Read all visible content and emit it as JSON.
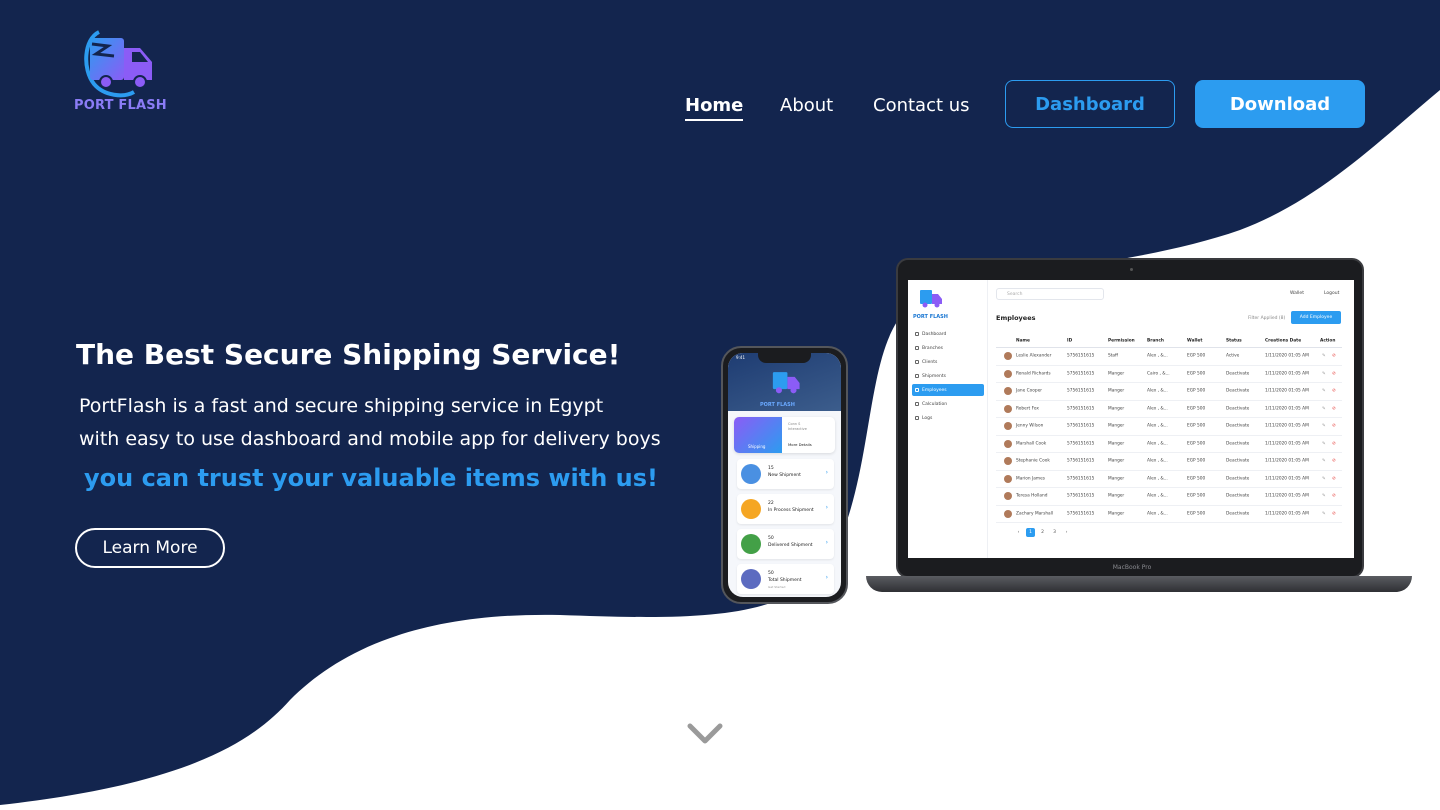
{
  "brand": {
    "name": "PORT FLASH",
    "colors": {
      "navy": "#13254e",
      "accent": "#2c9cf0",
      "logo_purple": "#8b7cf6"
    }
  },
  "nav": {
    "home": "Home",
    "about": "About",
    "contact": "Contact us",
    "dashboard_button": "Dashboard",
    "download_button": "Download"
  },
  "hero": {
    "title": "The Best Secure Shipping Service!",
    "line1": "PortFlash is a fast and secure shipping service in Egypt",
    "line2": "with easy to use dashboard and mobile app for delivery boys",
    "accent": "you can trust your valuable items with us!",
    "cta": "Learn More"
  },
  "scroll_icon": "chevron-down-icon",
  "laptop": {
    "brand_label": "MacBook Pro",
    "app": {
      "logo_text": "PORT FLASH",
      "search_placeholder": "Search",
      "wallet": "Wallet",
      "logout": "Logout",
      "sidebar": [
        "Dashboard",
        "Branches",
        "Clients",
        "Shipments",
        "Employees",
        "Calculation",
        "Logs"
      ],
      "active_index": 4,
      "page_title": "Employees",
      "filter_label": "Filter Applied (8)",
      "add_button": "Add Employee",
      "columns": [
        "Name",
        "ID",
        "Permission",
        "Branch",
        "Wallet",
        "Status",
        "Creations Date",
        "Action"
      ],
      "rows": [
        [
          "Leslie Alexander",
          "5756151615",
          "Staff",
          "Alex , &...",
          "EGP 500",
          "Active",
          "1/11/2020 01:05 AM"
        ],
        [
          "Ronald Richards",
          "5756151615",
          "Manger",
          "Cairo , &...",
          "EGP 500",
          "Deactivate",
          "1/11/2020 01:05 AM"
        ],
        [
          "Jane Cooper",
          "5756151615",
          "Manger",
          "Alex , &...",
          "EGP 500",
          "Deactivate",
          "1/11/2020 01:05 AM"
        ],
        [
          "Robert Fox",
          "5756151615",
          "Manger",
          "Alex , &...",
          "EGP 500",
          "Deactivate",
          "1/11/2020 01:05 AM"
        ],
        [
          "Jenny Wilson",
          "5756151615",
          "Manger",
          "Alex , &...",
          "EGP 500",
          "Deactivate",
          "1/11/2020 01:05 AM"
        ],
        [
          "Marshall Cook",
          "5756151615",
          "Manger",
          "Alex , &...",
          "EGP 500",
          "Deactivate",
          "1/11/2020 01:05 AM"
        ],
        [
          "Stephanie Cook",
          "5756151615",
          "Manger",
          "Alex , &...",
          "EGP 500",
          "Deactivate",
          "1/11/2020 01:05 AM"
        ],
        [
          "Marion James",
          "5756151615",
          "Manger",
          "Alex , &...",
          "EGP 500",
          "Deactivate",
          "1/11/2020 01:05 AM"
        ],
        [
          "Teresa Holland",
          "5756151615",
          "Manger",
          "Alex , &...",
          "EGP 500",
          "Deactivate",
          "1/11/2020 01:05 AM"
        ],
        [
          "Zachary Marshall",
          "5756151615",
          "Manger",
          "Alex , &...",
          "EGP 500",
          "Deactivate",
          "1/11/2020 01:05 AM"
        ]
      ],
      "pages": [
        "‹",
        "1",
        "2",
        "3",
        "›"
      ]
    }
  },
  "phone": {
    "time": "9:41",
    "logo_text": "PORT FLASH",
    "card_label": "Shipping",
    "card_right_1": "Conn S",
    "card_right_2": "Interactive",
    "card_more": "More Details",
    "items": [
      {
        "count": "15",
        "label": "New Shipment",
        "sub": "",
        "color": "#4a90e2"
      },
      {
        "count": "22",
        "label": "In Process Shipment",
        "sub": "",
        "color": "#f5a623"
      },
      {
        "count": "50",
        "label": "Delivered Shipment",
        "sub": "",
        "color": "#43a047"
      },
      {
        "count": "50",
        "label": "Total Shipment",
        "sub": "Get Started",
        "color": "#5c6bc0"
      }
    ]
  }
}
